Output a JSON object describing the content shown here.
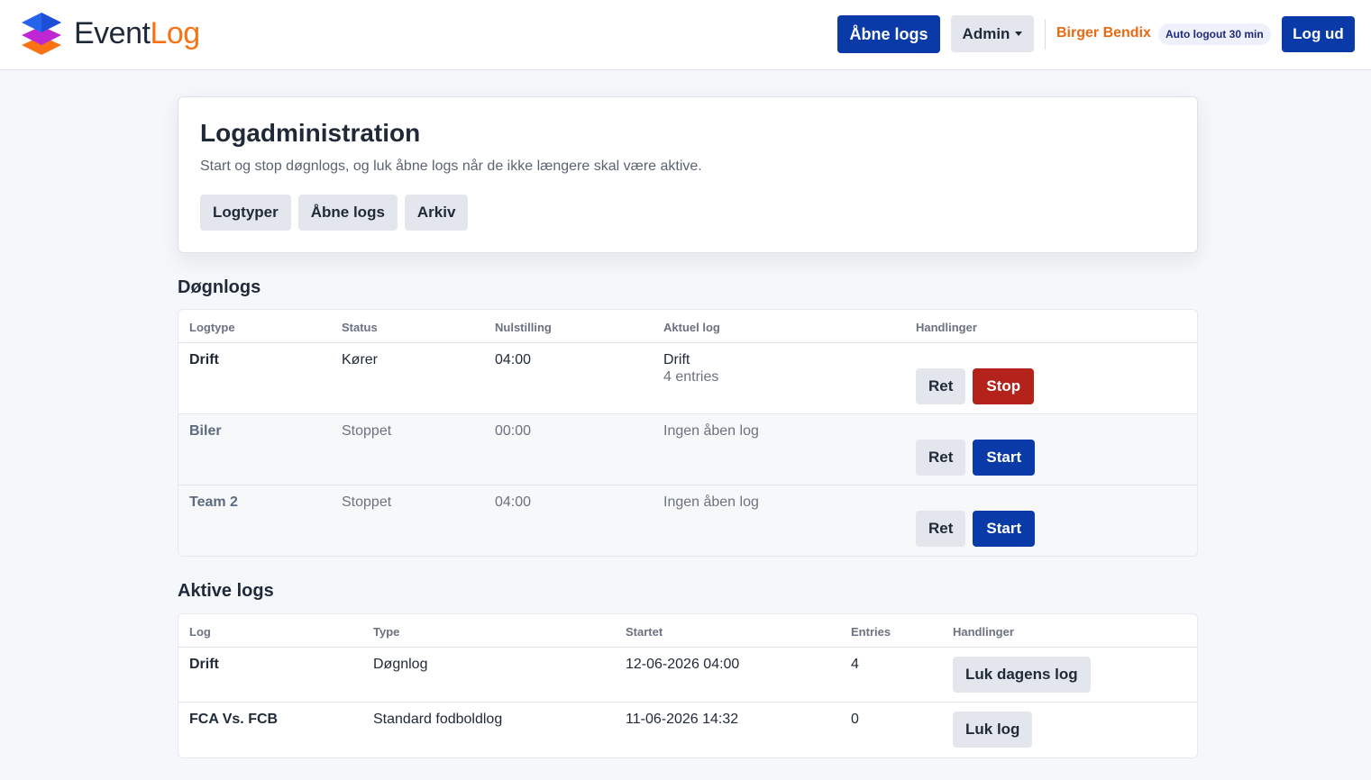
{
  "header": {
    "brand_part1": "Event",
    "brand_part2": "Log",
    "open_logs_button": "Åbne logs",
    "admin_menu": "Admin",
    "user_name": "Birger Bendix",
    "auto_logout": "Auto logout 30 min",
    "logout_button": "Log ud"
  },
  "card": {
    "title": "Logadministration",
    "description": "Start og stop døgnlogs, og luk åbne logs når de ikke længere skal være aktive.",
    "tabs": [
      "Logtyper",
      "Åbne logs",
      "Arkiv"
    ]
  },
  "daily": {
    "title": "Døgnlogs",
    "columns": [
      "Logtype",
      "Status",
      "Nulstilling",
      "Aktuel log",
      "Handlinger"
    ],
    "rows": [
      {
        "logtype": "Drift",
        "status": "Kører",
        "reset": "04:00",
        "current": "Drift",
        "current_sub": "4 entries",
        "edit": "Ret",
        "action": "Stop"
      },
      {
        "logtype": "Biler",
        "status": "Stoppet",
        "reset": "00:00",
        "current": "Ingen åben log",
        "current_sub": "",
        "edit": "Ret",
        "action": "Start"
      },
      {
        "logtype": "Team 2",
        "status": "Stoppet",
        "reset": "04:00",
        "current": "Ingen åben log",
        "current_sub": "",
        "edit": "Ret",
        "action": "Start"
      }
    ]
  },
  "active": {
    "title": "Aktive logs",
    "columns": [
      "Log",
      "Type",
      "Startet",
      "Entries",
      "Handlinger"
    ],
    "rows": [
      {
        "log": "Drift",
        "type": "Døgnlog",
        "started": "12-06-2026 04:00",
        "entries": "4",
        "action": "Luk dagens log"
      },
      {
        "log": "FCA Vs. FCB",
        "type": "Standard fodboldlog",
        "started": "11-06-2026 14:32",
        "entries": "0",
        "action": "Luk log"
      }
    ]
  },
  "colors": {
    "primary": "#0a3aa8",
    "danger": "#b3231b",
    "accent_orange": "#f97316"
  }
}
